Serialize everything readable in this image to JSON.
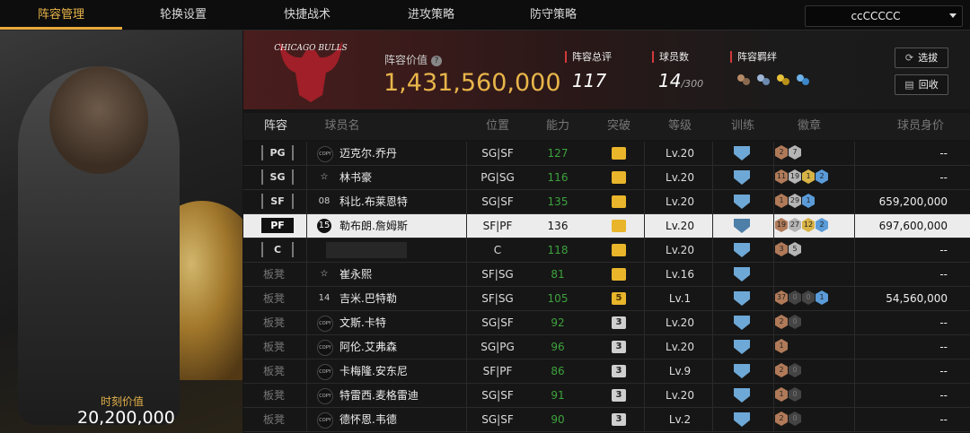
{
  "tabs": [
    "阵容管理",
    "轮换设置",
    "快捷战术",
    "进攻策略",
    "防守策略"
  ],
  "team_selector": {
    "value": "ccCCCCC"
  },
  "featured": {
    "value_label": "时刻价值",
    "value": "20,200,000"
  },
  "header": {
    "logo_text": "CHICAGO BULLS",
    "value_label": "阵容价值",
    "value": "1,431,560,000",
    "rating_label": "阵容总评",
    "rating": "117",
    "count_label": "球员数",
    "count": "14",
    "count_max": "/300",
    "bond_label": "阵容羁绊",
    "btn_select": "选拔",
    "btn_recycle": "回收"
  },
  "columns": {
    "lineup": "阵容",
    "name": "球员名",
    "position": "位置",
    "ability": "能力",
    "breakthrough": "突破",
    "level": "等级",
    "training": "训练",
    "badges": "徽章",
    "worth": "球员身价"
  },
  "rows": [
    {
      "slot": "PG",
      "bench": false,
      "icon": "COPY",
      "name": "迈克尔.乔丹",
      "position": "SG|SF",
      "ability": "127",
      "brk": "gold",
      "brk_text": "",
      "level": "Lv.20",
      "badges": [
        [
          "b",
          "2"
        ],
        [
          "s",
          "7"
        ]
      ],
      "worth": "--",
      "selected": false
    },
    {
      "slot": "SG",
      "bench": false,
      "icon": "star",
      "name": "林书豪",
      "position": "PG|SG",
      "ability": "116",
      "brk": "gold",
      "brk_text": "",
      "level": "Lv.20",
      "badges": [
        [
          "b",
          "11"
        ],
        [
          "s",
          "19"
        ],
        [
          "g",
          "1"
        ],
        [
          "h",
          "2"
        ]
      ],
      "worth": "--",
      "selected": false
    },
    {
      "slot": "SF",
      "bench": false,
      "icon": "08",
      "name": "科比.布莱恩特",
      "position": "SG|SF",
      "ability": "135",
      "brk": "gold",
      "brk_text": "",
      "level": "Lv.20",
      "badges": [
        [
          "b",
          "1"
        ],
        [
          "s",
          "29"
        ],
        [
          "h",
          "1"
        ]
      ],
      "worth": "659,200,000",
      "selected": false
    },
    {
      "slot": "PF",
      "bench": false,
      "icon": "15",
      "name": "勒布朗.詹姆斯",
      "position": "SF|PF",
      "ability": "136",
      "brk": "gold",
      "brk_text": "",
      "level": "Lv.20",
      "badges": [
        [
          "b",
          "19"
        ],
        [
          "s",
          "27"
        ],
        [
          "g",
          "12"
        ],
        [
          "h",
          "2"
        ]
      ],
      "worth": "697,600,000",
      "selected": true
    },
    {
      "slot": "C",
      "bench": false,
      "icon": "blur",
      "name": "",
      "position": "C",
      "ability": "118",
      "brk": "gold",
      "brk_text": "",
      "level": "Lv.20",
      "badges": [
        [
          "b",
          "3"
        ],
        [
          "s",
          "5"
        ]
      ],
      "worth": "--",
      "selected": false
    },
    {
      "slot": "板凳",
      "bench": true,
      "icon": "star",
      "name": "崔永熙",
      "position": "SF|SG",
      "ability": "81",
      "brk": "gold",
      "brk_text": "",
      "level": "Lv.16",
      "badges": [],
      "worth": "--",
      "selected": false
    },
    {
      "slot": "板凳",
      "bench": true,
      "icon": "14",
      "name": "吉米.巴特勒",
      "position": "SF|SG",
      "ability": "105",
      "brk": "gold",
      "brk_text": "5",
      "level": "Lv.1",
      "badges": [
        [
          "b",
          "37"
        ],
        [
          "d",
          "0"
        ],
        [
          "d",
          "0"
        ],
        [
          "h",
          "1"
        ]
      ],
      "worth": "54,560,000",
      "selected": false
    },
    {
      "slot": "板凳",
      "bench": true,
      "icon": "COPY",
      "name": "文斯.卡特",
      "position": "SG|SF",
      "ability": "92",
      "brk": "silver",
      "brk_text": "3",
      "level": "Lv.20",
      "badges": [
        [
          "b",
          "2"
        ],
        [
          "d",
          "0"
        ]
      ],
      "worth": "--",
      "selected": false
    },
    {
      "slot": "板凳",
      "bench": true,
      "icon": "COPY",
      "name": "阿伦.艾弗森",
      "position": "SG|PG",
      "ability": "96",
      "brk": "silver",
      "brk_text": "3",
      "level": "Lv.20",
      "badges": [
        [
          "b",
          "1"
        ]
      ],
      "worth": "--",
      "selected": false
    },
    {
      "slot": "板凳",
      "bench": true,
      "icon": "COPY",
      "name": "卡梅隆.安东尼",
      "position": "SF|PF",
      "ability": "86",
      "brk": "silver",
      "brk_text": "3",
      "level": "Lv.9",
      "badges": [
        [
          "b",
          "2"
        ],
        [
          "d",
          "0"
        ]
      ],
      "worth": "--",
      "selected": false
    },
    {
      "slot": "板凳",
      "bench": true,
      "icon": "COPY",
      "name": "特雷西.麦格雷迪",
      "position": "SG|SF",
      "ability": "91",
      "brk": "silver",
      "brk_text": "3",
      "level": "Lv.20",
      "badges": [
        [
          "b",
          "1"
        ],
        [
          "d",
          "0"
        ]
      ],
      "worth": "--",
      "selected": false
    },
    {
      "slot": "板凳",
      "bench": true,
      "icon": "COPY",
      "name": "德怀恩.韦德",
      "position": "SG|SF",
      "ability": "90",
      "brk": "silver",
      "brk_text": "3",
      "level": "Lv.2",
      "badges": [
        [
          "b",
          "2"
        ],
        [
          "d",
          "0"
        ]
      ],
      "worth": "--",
      "selected": false
    }
  ]
}
